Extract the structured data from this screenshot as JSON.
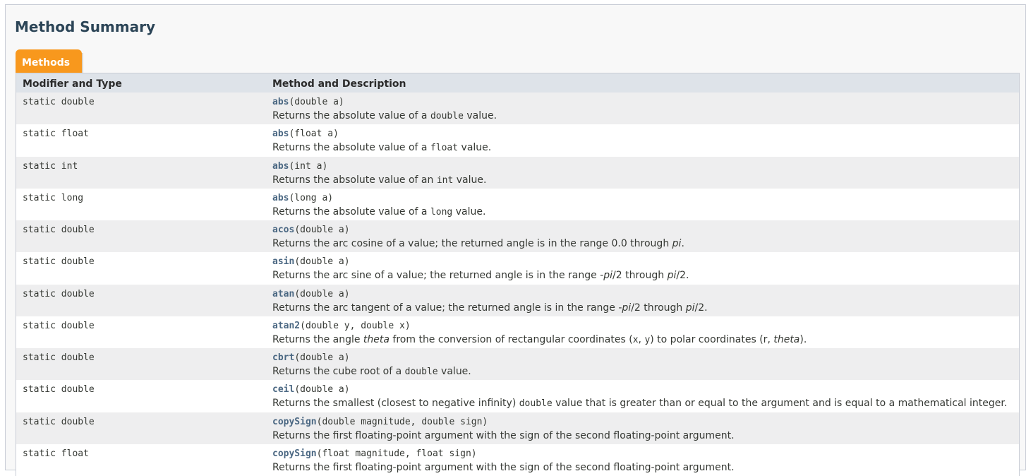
{
  "section": {
    "title": "Method Summary",
    "tab_label": "Methods"
  },
  "table": {
    "headers": {
      "modifier": "Modifier and Type",
      "method": "Method and Description"
    },
    "rows": [
      {
        "modifier": "static double",
        "name": "abs",
        "params": "(double a)",
        "desc": [
          {
            "t": "Returns the absolute value of a "
          },
          {
            "t": "double",
            "code": true
          },
          {
            "t": " value."
          }
        ]
      },
      {
        "modifier": "static float",
        "name": "abs",
        "params": "(float a)",
        "desc": [
          {
            "t": "Returns the absolute value of a "
          },
          {
            "t": "float",
            "code": true
          },
          {
            "t": " value."
          }
        ]
      },
      {
        "modifier": "static int",
        "name": "abs",
        "params": "(int a)",
        "desc": [
          {
            "t": "Returns the absolute value of an "
          },
          {
            "t": "int",
            "code": true
          },
          {
            "t": " value."
          }
        ]
      },
      {
        "modifier": "static long",
        "name": "abs",
        "params": "(long a)",
        "desc": [
          {
            "t": "Returns the absolute value of a "
          },
          {
            "t": "long",
            "code": true
          },
          {
            "t": " value."
          }
        ]
      },
      {
        "modifier": "static double",
        "name": "acos",
        "params": "(double a)",
        "desc": [
          {
            "t": "Returns the arc cosine of a value; the returned angle is in the range 0.0 through "
          },
          {
            "t": "pi",
            "em": true
          },
          {
            "t": "."
          }
        ]
      },
      {
        "modifier": "static double",
        "name": "asin",
        "params": "(double a)",
        "desc": [
          {
            "t": "Returns the arc sine of a value; the returned angle is in the range -"
          },
          {
            "t": "pi",
            "em": true
          },
          {
            "t": "/2 through "
          },
          {
            "t": "pi",
            "em": true
          },
          {
            "t": "/2."
          }
        ]
      },
      {
        "modifier": "static double",
        "name": "atan",
        "params": "(double a)",
        "desc": [
          {
            "t": "Returns the arc tangent of a value; the returned angle is in the range -"
          },
          {
            "t": "pi",
            "em": true
          },
          {
            "t": "/2 through "
          },
          {
            "t": "pi",
            "em": true
          },
          {
            "t": "/2."
          }
        ]
      },
      {
        "modifier": "static double",
        "name": "atan2",
        "params": "(double y, double x)",
        "desc": [
          {
            "t": "Returns the angle "
          },
          {
            "t": "theta",
            "em": true
          },
          {
            "t": " from the conversion of rectangular coordinates ("
          },
          {
            "t": "x",
            "code": true
          },
          {
            "t": ", "
          },
          {
            "t": "y",
            "code": true
          },
          {
            "t": ") to polar coordinates (r, "
          },
          {
            "t": "theta",
            "em": true
          },
          {
            "t": ")."
          }
        ]
      },
      {
        "modifier": "static double",
        "name": "cbrt",
        "params": "(double a)",
        "desc": [
          {
            "t": "Returns the cube root of a "
          },
          {
            "t": "double",
            "code": true
          },
          {
            "t": " value."
          }
        ]
      },
      {
        "modifier": "static double",
        "name": "ceil",
        "params": "(double a)",
        "desc": [
          {
            "t": "Returns the smallest (closest to negative infinity) "
          },
          {
            "t": "double",
            "code": true
          },
          {
            "t": " value that is greater than or equal to the argument and is equal to a mathematical integer."
          }
        ]
      },
      {
        "modifier": "static double",
        "name": "copySign",
        "params": "(double magnitude, double sign)",
        "desc": [
          {
            "t": "Returns the first floating-point argument with the sign of the second floating-point argument."
          }
        ]
      },
      {
        "modifier": "static float",
        "name": "copySign",
        "params": "(float magnitude, float sign)",
        "desc": [
          {
            "t": "Returns the first floating-point argument with the sign of the second floating-point argument."
          }
        ]
      }
    ]
  }
}
